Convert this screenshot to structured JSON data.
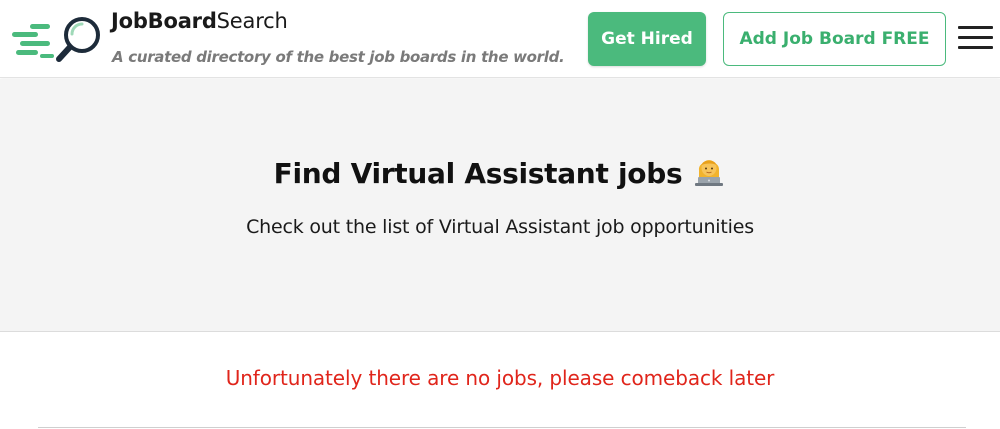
{
  "header": {
    "logo_icon": "magnifier-speed-icon",
    "brand_bold": "JobBoard",
    "brand_light": "Search",
    "tagline": "A curated directory of the best job boards in the world.",
    "get_hired_label": "Get Hired",
    "add_board_label": "Add Job Board FREE",
    "menu_icon": "hamburger-menu-icon"
  },
  "hero": {
    "title": "Find Virtual Assistant jobs",
    "title_emoji_icon": "woman-technologist-emoji",
    "subtitle": "Check out the list of Virtual Assistant job opportunities"
  },
  "listing": {
    "empty_message": "Unfortunately there are no jobs, please comeback later"
  },
  "colors": {
    "brand_green": "#4bba7d",
    "error_red": "#e0251b",
    "hero_background": "#f4f4f4"
  }
}
